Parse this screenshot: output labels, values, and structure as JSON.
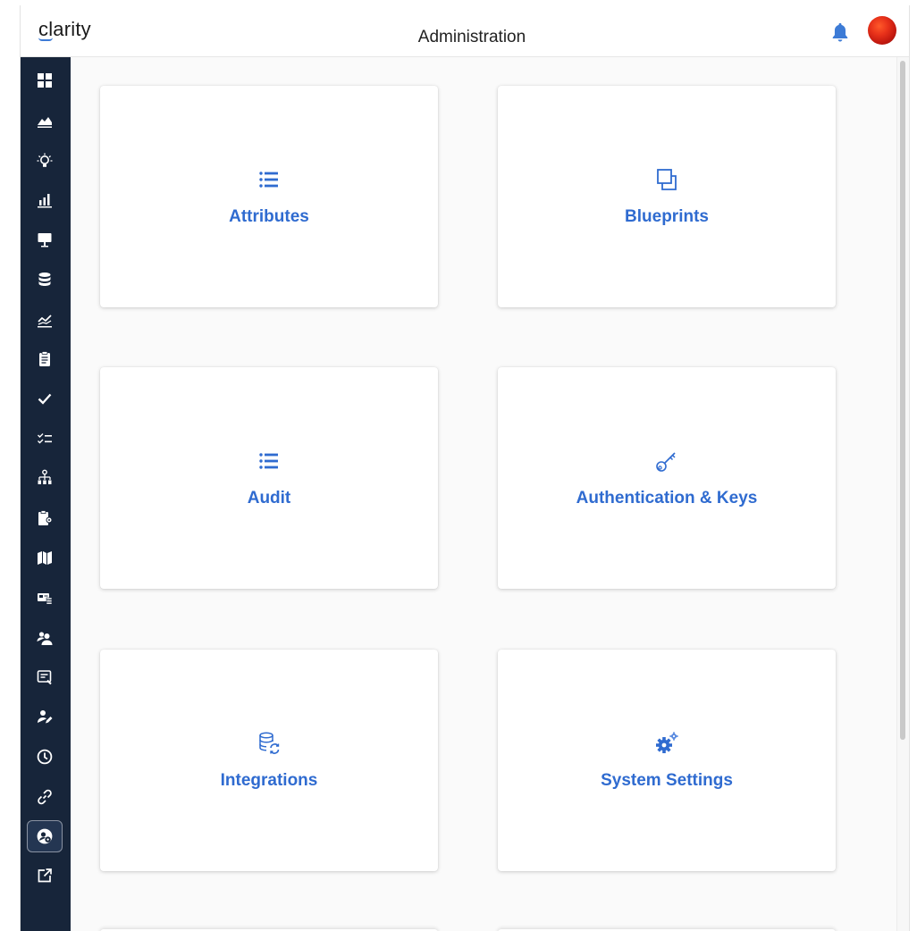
{
  "header": {
    "logo": "clarity",
    "title": "Administration",
    "bell_icon": "bell-icon",
    "avatar_icon": "avatar-icon"
  },
  "sidebar": {
    "items": [
      {
        "name": "dashboard-icon"
      },
      {
        "name": "area-chart-icon"
      },
      {
        "name": "lightbulb-icon"
      },
      {
        "name": "bar-chart-icon"
      },
      {
        "name": "presentation-icon"
      },
      {
        "name": "database-icon"
      },
      {
        "name": "line-chart-icon"
      },
      {
        "name": "clipboard-icon"
      },
      {
        "name": "check-icon"
      },
      {
        "name": "checklist-icon"
      },
      {
        "name": "hierarchy-icon"
      },
      {
        "name": "clipboard-settings-icon"
      },
      {
        "name": "map-icon"
      },
      {
        "name": "id-card-icon"
      },
      {
        "name": "users-icon"
      },
      {
        "name": "note-icon"
      },
      {
        "name": "user-edit-icon"
      },
      {
        "name": "clock-icon"
      },
      {
        "name": "link-icon"
      },
      {
        "name": "admin-settings-icon",
        "active": true
      },
      {
        "name": "pop-out-icon"
      }
    ]
  },
  "cards": [
    {
      "label": "Attributes",
      "icon": "list-icon"
    },
    {
      "label": "Blueprints",
      "icon": "copy-icon"
    },
    {
      "label": "Audit",
      "icon": "list-icon"
    },
    {
      "label": "Authentication & Keys",
      "icon": "key-icon"
    },
    {
      "label": "Integrations",
      "icon": "database-sync-icon"
    },
    {
      "label": "System Settings",
      "icon": "gears-icon"
    }
  ],
  "colors": {
    "accent": "#2f6bd0",
    "sidebar_bg": "#17253a",
    "sidebar_icon": "#ffffff",
    "bell": "#3d7bd6",
    "page_bg": "#fafafa"
  }
}
